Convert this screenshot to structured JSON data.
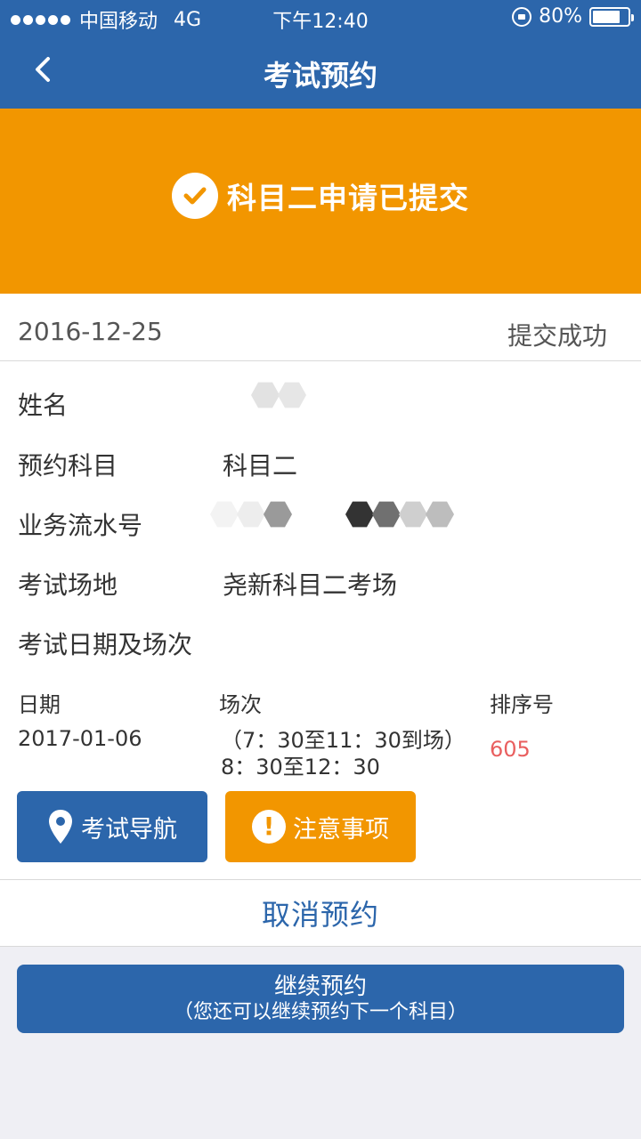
{
  "status_bar": {
    "carrier": "中国移动",
    "network": "4G",
    "time": "下午12:40",
    "battery_text": "80%",
    "battery_level": 0.8
  },
  "nav": {
    "title": "考试预约",
    "back_icon": "chevron-left-icon"
  },
  "banner": {
    "icon": "check-circle-icon",
    "message": "科目二申请已提交"
  },
  "summary": {
    "date": "2016-12-25",
    "status": "提交成功"
  },
  "fields": {
    "name_label": "姓名",
    "subject_label": "预约科目",
    "subject_value": "科目二",
    "serial_label": "业务流水号",
    "venue_label": "考试场地",
    "venue_value": "尧新科目二考场",
    "schedule_label": "考试日期及场次"
  },
  "schedule": {
    "date_header": "日期",
    "session_header": "场次",
    "rank_header": "排序号",
    "date_value": "2017-01-06",
    "session_line1": "（7：30至11：30到场）",
    "session_line2": "8：30至12：30",
    "rank_value": "605"
  },
  "buttons": {
    "navigate_label": "考试导航",
    "notice_label": "注意事项",
    "cancel_label": "取消预约",
    "continue_label": "继续预约",
    "continue_sub": "（您还可以继续预约下一个科目）"
  },
  "colors": {
    "primary": "#2c66ab",
    "accent": "#f29600",
    "rank": "#e95f5f",
    "background": "#efeff4"
  }
}
